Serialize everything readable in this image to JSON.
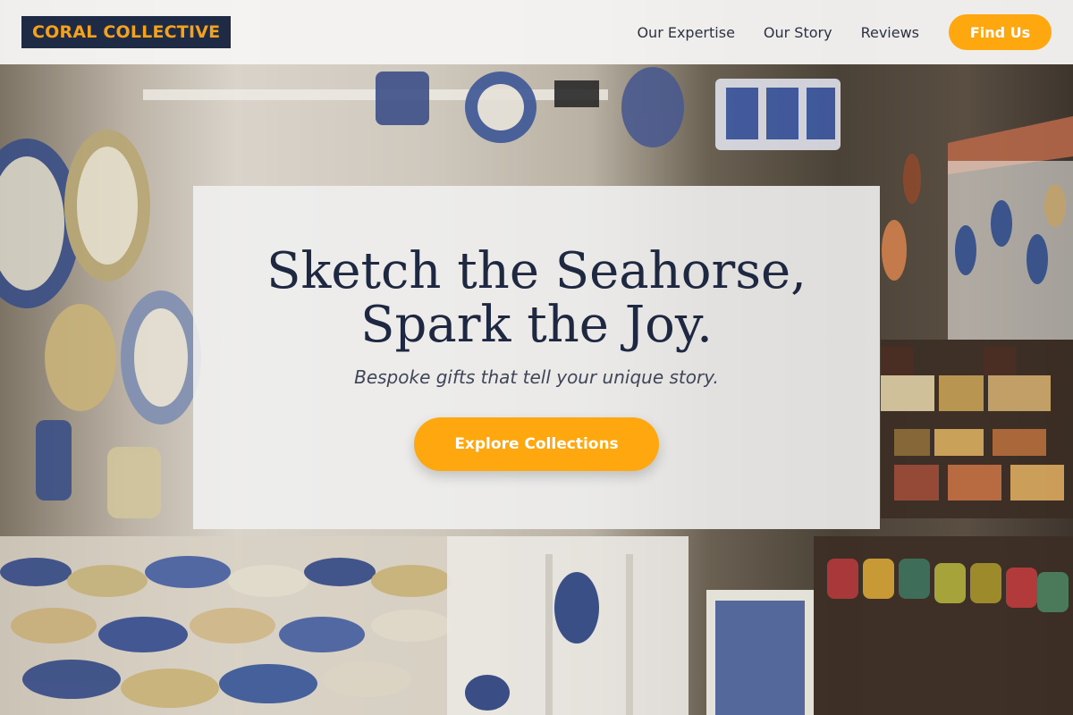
{
  "header": {
    "logo_text": "CORAL COLLECTIVE",
    "nav": [
      {
        "label": "Our Expertise"
      },
      {
        "label": "Our Story"
      },
      {
        "label": "Reviews"
      }
    ],
    "cta_label": "Find Us"
  },
  "hero": {
    "title_line1": "Sketch the Seahorse,",
    "title_line2": "Spark the Joy.",
    "subtitle": "Bespoke gifts that tell your unique story.",
    "cta_label": "Explore Collections",
    "background_description_icon": "ceramic-shop-photo"
  },
  "colors": {
    "accent": "#ffa70f",
    "navy": "#1f2a44",
    "logo_text": "#f4a21b"
  }
}
